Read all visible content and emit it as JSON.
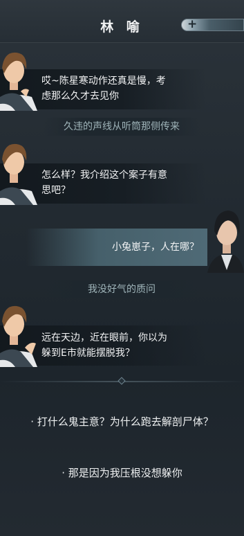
{
  "header": {
    "title": "林 喻",
    "add_icon": "+"
  },
  "messages": [
    {
      "speaker": "left",
      "line1": "哎~陈星寒动作还真是慢，考",
      "line2": "虑那么久才去见你"
    },
    {
      "speaker": "narration",
      "text": "久违的声线从听筒那侧传来"
    },
    {
      "speaker": "left",
      "line1": "怎么样？我介绍这个案子有意",
      "line2": "思吧？"
    },
    {
      "speaker": "right",
      "text": "小兔崽子，人在哪？"
    },
    {
      "speaker": "narration",
      "text": "我没好气的质问"
    },
    {
      "speaker": "left",
      "line1": "远在天边，近在眼前，你以为",
      "line2": "躲到E市就能摆脱我？"
    }
  ],
  "choices": [
    {
      "label": "· 打什么鬼主意？为什么跑去解剖尸体？"
    },
    {
      "label": "· 那是因为我压根没想躲你"
    }
  ]
}
